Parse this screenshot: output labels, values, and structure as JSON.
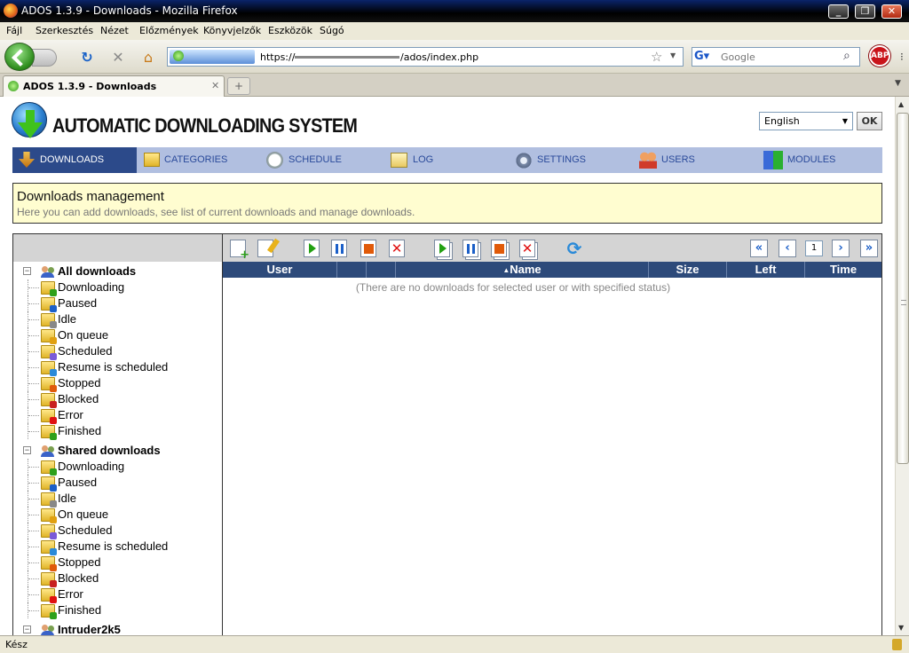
{
  "window": {
    "title": "ADOS 1.3.9 - Downloads - Mozilla Firefox",
    "minimize": "_",
    "maximize": "❐",
    "close": "✕"
  },
  "menu": [
    "Fájl",
    "Szerkesztés",
    "Nézet",
    "Előzmények",
    "Könyvjelzők",
    "Eszközök",
    "Súgó"
  ],
  "addressbar": {
    "url_prefix": "https://",
    "url_suffix": "/ados/index.php"
  },
  "search": {
    "placeholder": "Google"
  },
  "adblock_label": "ABP",
  "tab": {
    "title": "ADOS 1.3.9 - Downloads"
  },
  "app": {
    "title": "AUTOMATIC DOWNLOADING SYSTEM",
    "language": "English",
    "ok_label": "OK"
  },
  "nav": [
    {
      "label": "DOWNLOADS",
      "active": true
    },
    {
      "label": "CATEGORIES",
      "active": false
    },
    {
      "label": "SCHEDULE",
      "active": false
    },
    {
      "label": "LOG",
      "active": false
    },
    {
      "label": "SETTINGS",
      "active": false
    },
    {
      "label": "USERS",
      "active": false
    },
    {
      "label": "MODULES",
      "active": false
    }
  ],
  "info": {
    "heading": "Downloads management",
    "subtitle": "Here you can add downloads, see list of current downloads and manage downloads."
  },
  "tree": {
    "groups": [
      {
        "label": "All downloads",
        "items": [
          "Downloading",
          "Paused",
          "Idle",
          "On queue",
          "Scheduled",
          "Resume is scheduled",
          "Stopped",
          "Blocked",
          "Error",
          "Finished"
        ]
      },
      {
        "label": "Shared downloads",
        "items": [
          "Downloading",
          "Paused",
          "Idle",
          "On queue",
          "Scheduled",
          "Resume is scheduled",
          "Stopped",
          "Blocked",
          "Error",
          "Finished"
        ]
      },
      {
        "label": "Intruder2k5",
        "items": []
      }
    ]
  },
  "pager": {
    "page": "1"
  },
  "table": {
    "columns": [
      "User",
      "",
      "",
      "Name",
      "Size",
      "Left",
      "Time"
    ],
    "sort_indicator": "▲",
    "empty_message": "(There are no downloads for selected user or with specified status)"
  },
  "status": {
    "text": "Kész"
  },
  "colors": {
    "nav_bg": "#b1bfe0",
    "nav_active": "#2c4a8a",
    "table_header": "#2d4a7a",
    "info_bg": "#fffdd0"
  }
}
